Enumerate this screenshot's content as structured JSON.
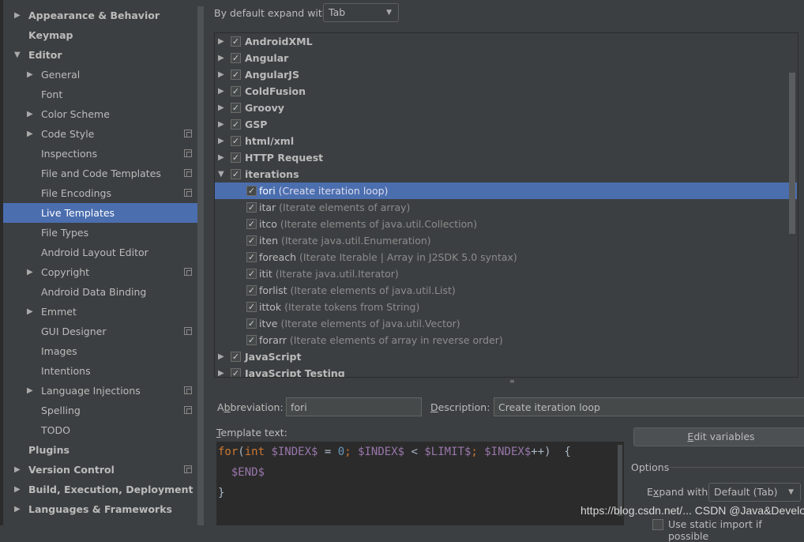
{
  "sidebar": {
    "items": [
      {
        "label": "Appearance & Behavior",
        "level": 0,
        "expand": "collapsed"
      },
      {
        "label": "Keymap",
        "level": 0
      },
      {
        "label": "Editor",
        "level": 0,
        "expand": "expanded"
      },
      {
        "label": "General",
        "level": 1,
        "expand": "collapsed"
      },
      {
        "label": "Font",
        "level": 1
      },
      {
        "label": "Color Scheme",
        "level": 1,
        "expand": "collapsed"
      },
      {
        "label": "Code Style",
        "level": 1,
        "expand": "collapsed",
        "copy": true
      },
      {
        "label": "Inspections",
        "level": 1,
        "copy": true
      },
      {
        "label": "File and Code Templates",
        "level": 1,
        "copy": true
      },
      {
        "label": "File Encodings",
        "level": 1,
        "copy": true
      },
      {
        "label": "Live Templates",
        "level": 1,
        "selected": true
      },
      {
        "label": "File Types",
        "level": 1
      },
      {
        "label": "Android Layout Editor",
        "level": 1
      },
      {
        "label": "Copyright",
        "level": 1,
        "expand": "collapsed",
        "copy": true
      },
      {
        "label": "Android Data Binding",
        "level": 1
      },
      {
        "label": "Emmet",
        "level": 1,
        "expand": "collapsed"
      },
      {
        "label": "GUI Designer",
        "level": 1,
        "copy": true
      },
      {
        "label": "Images",
        "level": 1
      },
      {
        "label": "Intentions",
        "level": 1
      },
      {
        "label": "Language Injections",
        "level": 1,
        "expand": "collapsed",
        "copy": true
      },
      {
        "label": "Spelling",
        "level": 1,
        "copy": true
      },
      {
        "label": "TODO",
        "level": 1
      },
      {
        "label": "Plugins",
        "level": 0
      },
      {
        "label": "Version Control",
        "level": 0,
        "expand": "collapsed",
        "copy": true
      },
      {
        "label": "Build, Execution, Deployment",
        "level": 0,
        "expand": "collapsed"
      },
      {
        "label": "Languages & Frameworks",
        "level": 0,
        "expand": "collapsed"
      }
    ]
  },
  "top": {
    "expand_label": "By default expand with",
    "expand_value": "Tab"
  },
  "tree": {
    "rows": [
      {
        "name": "AndroidXML",
        "group": true,
        "expand": "collapsed"
      },
      {
        "name": "Angular",
        "group": true,
        "expand": "collapsed"
      },
      {
        "name": "AngularJS",
        "group": true,
        "expand": "collapsed"
      },
      {
        "name": "ColdFusion",
        "group": true,
        "expand": "collapsed"
      },
      {
        "name": "Groovy",
        "group": true,
        "expand": "collapsed"
      },
      {
        "name": "GSP",
        "group": true,
        "expand": "collapsed"
      },
      {
        "name": "html/xml",
        "group": true,
        "expand": "collapsed"
      },
      {
        "name": "HTTP Request",
        "group": true,
        "expand": "collapsed"
      },
      {
        "name": "iterations",
        "group": true,
        "expand": "expanded"
      },
      {
        "name": "fori",
        "desc": "(Create iteration loop)",
        "selected": true
      },
      {
        "name": "itar",
        "desc": "(Iterate elements of array)"
      },
      {
        "name": "itco",
        "desc": "(Iterate elements of java.util.Collection)"
      },
      {
        "name": "iten",
        "desc": "(Iterate java.util.Enumeration)"
      },
      {
        "name": "foreach",
        "desc": "(Iterate Iterable | Array in J2SDK 5.0 syntax)"
      },
      {
        "name": "itit",
        "desc": "(Iterate java.util.Iterator)"
      },
      {
        "name": "forlist",
        "desc": "(Iterate elements of java.util.List)"
      },
      {
        "name": "ittok",
        "desc": "(Iterate tokens from String)"
      },
      {
        "name": "itve",
        "desc": "(Iterate elements of java.util.Vector)"
      },
      {
        "name": "forarr",
        "desc": "(Iterate elements of array in reverse order)"
      },
      {
        "name": "JavaScript",
        "group": true,
        "expand": "collapsed"
      },
      {
        "name": "JavaScript Testing",
        "group": true,
        "expand": "collapsed"
      }
    ]
  },
  "form": {
    "abbr_label_pre": "A",
    "abbr_label_u": "b",
    "abbr_label_post": "breviation:",
    "abbr_value": "fori",
    "desc_label_pre": "",
    "desc_label_u": "D",
    "desc_label_post": "escription:",
    "desc_value": "Create iteration loop",
    "template_label_u": "T",
    "template_label_post": "emplate text:",
    "edit_vars_u": "E",
    "edit_vars_post": "dit variables",
    "options_label": "Options",
    "expand_with_pre": "E",
    "expand_with_u": "x",
    "expand_with_post": "pand with",
    "expand_with_value": "Default (Tab)",
    "static_import": "Use static import if possible"
  },
  "code": {
    "l1": [
      [
        "kw",
        "for"
      ],
      [
        "pl",
        "("
      ],
      [
        "kw",
        "int "
      ],
      [
        "vr",
        "$INDEX$"
      ],
      [
        "pl",
        " = "
      ],
      [
        "nm",
        "0"
      ],
      [
        "kw",
        "; "
      ],
      [
        "vr",
        "$INDEX$"
      ],
      [
        "pl",
        " < "
      ],
      [
        "vr",
        "$LIMIT$"
      ],
      [
        "kw",
        "; "
      ],
      [
        "vr",
        "$INDEX$"
      ],
      [
        "pl",
        "++)  {"
      ]
    ],
    "l2": "  $END$",
    "l3": "}"
  },
  "watermark": "https://blog.csdn.net/...   CSDN @Java&Develop"
}
